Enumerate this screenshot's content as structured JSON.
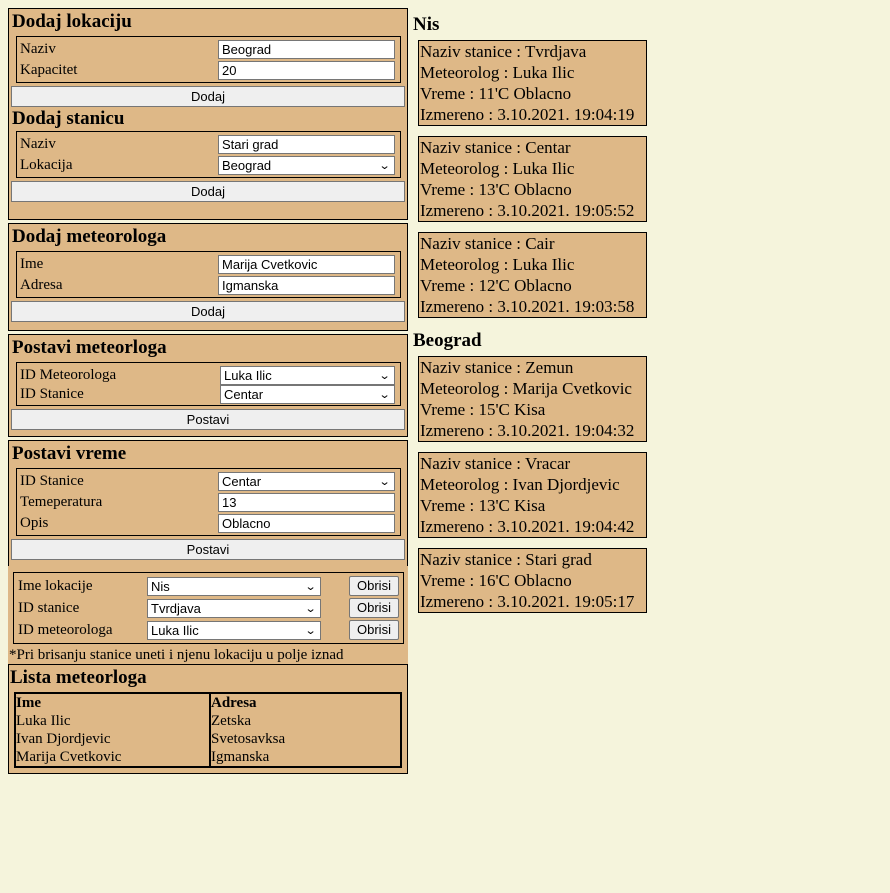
{
  "add_location": {
    "title": "Dodaj lokaciju",
    "fields": [
      {
        "label": "Naziv",
        "value": "Beograd"
      },
      {
        "label": "Kapacitet",
        "value": "20"
      }
    ],
    "button": "Dodaj"
  },
  "add_station": {
    "title": "Dodaj stanicu",
    "naziv_label": "Naziv",
    "naziv_value": "Stari grad",
    "lokacija_label": "Lokacija",
    "lokacija_value": "Beograd",
    "button": "Dodaj"
  },
  "add_meteorologist": {
    "title": "Dodaj meteorologa",
    "fields": [
      {
        "label": "Ime",
        "value": "Marija Cvetkovic"
      },
      {
        "label": "Adresa",
        "value": "Igmanska"
      }
    ],
    "button": "Dodaj"
  },
  "set_meteorologist": {
    "title": "Postavi meteorloga",
    "meteo_label": "ID Meteorologa",
    "meteo_value": "Luka Ilic",
    "stanica_label": "ID Stanice",
    "stanica_value": "Centar",
    "button": "Postavi"
  },
  "set_weather": {
    "title": "Postavi vreme",
    "stanica_label": "ID Stanice",
    "stanica_value": "Centar",
    "temp_label": "Temeperatura",
    "temp_value": "13",
    "opis_label": "Opis",
    "opis_value": "Oblacno",
    "button": "Postavi"
  },
  "delete": {
    "rows": [
      {
        "label": "Ime lokacije",
        "value": "Nis",
        "button": "Obrisi"
      },
      {
        "label": "ID stanice",
        "value": "Tvrdjava",
        "button": "Obrisi"
      },
      {
        "label": "ID meteorologa",
        "value": "Luka Ilic",
        "button": "Obrisi"
      }
    ],
    "note": "*Pri brisanju stanice uneti i njenu lokaciju u polje iznad"
  },
  "meteorologists": {
    "title": "Lista meteorloga",
    "headers": [
      "Ime",
      "Adresa"
    ],
    "rows": [
      [
        "Luka Ilic",
        "Zetska"
      ],
      [
        "Ivan Djordjevic",
        "Svetosavksa"
      ],
      [
        "Marija Cvetkovic",
        "Igmanska"
      ]
    ]
  },
  "locations": [
    {
      "name": "Nis",
      "stations": [
        {
          "naziv": "Naziv stanice : Tvrdjava",
          "meteorolog": "Meteorolog : Luka Ilic",
          "vreme": "Vreme : 11'C Oblacno",
          "izmereno": "Izmereno : 3.10.2021. 19:04:19"
        },
        {
          "naziv": "Naziv stanice : Centar",
          "meteorolog": "Meteorolog : Luka Ilic",
          "vreme": "Vreme : 13'C Oblacno",
          "izmereno": "Izmereno : 3.10.2021. 19:05:52"
        },
        {
          "naziv": "Naziv stanice : Cair",
          "meteorolog": "Meteorolog : Luka Ilic",
          "vreme": "Vreme : 12'C Oblacno",
          "izmereno": "Izmereno : 3.10.2021. 19:03:58"
        }
      ]
    },
    {
      "name": "Beograd",
      "stations": [
        {
          "naziv": "Naziv stanice : Zemun",
          "meteorolog": "Meteorolog : Marija Cvetkovic",
          "vreme": "Vreme : 15'C Kisa",
          "izmereno": "Izmereno : 3.10.2021. 19:04:32"
        },
        {
          "naziv": "Naziv stanice : Vracar",
          "meteorolog": "Meteorolog : Ivan Djordjevic",
          "vreme": "Vreme : 13'C Kisa",
          "izmereno": "Izmereno : 3.10.2021. 19:04:42"
        },
        {
          "naziv": "Naziv stanice : Stari grad",
          "vreme": "Vreme : 16'C Oblacno",
          "izmereno": "Izmereno : 3.10.2021. 19:05:17"
        }
      ]
    }
  ]
}
